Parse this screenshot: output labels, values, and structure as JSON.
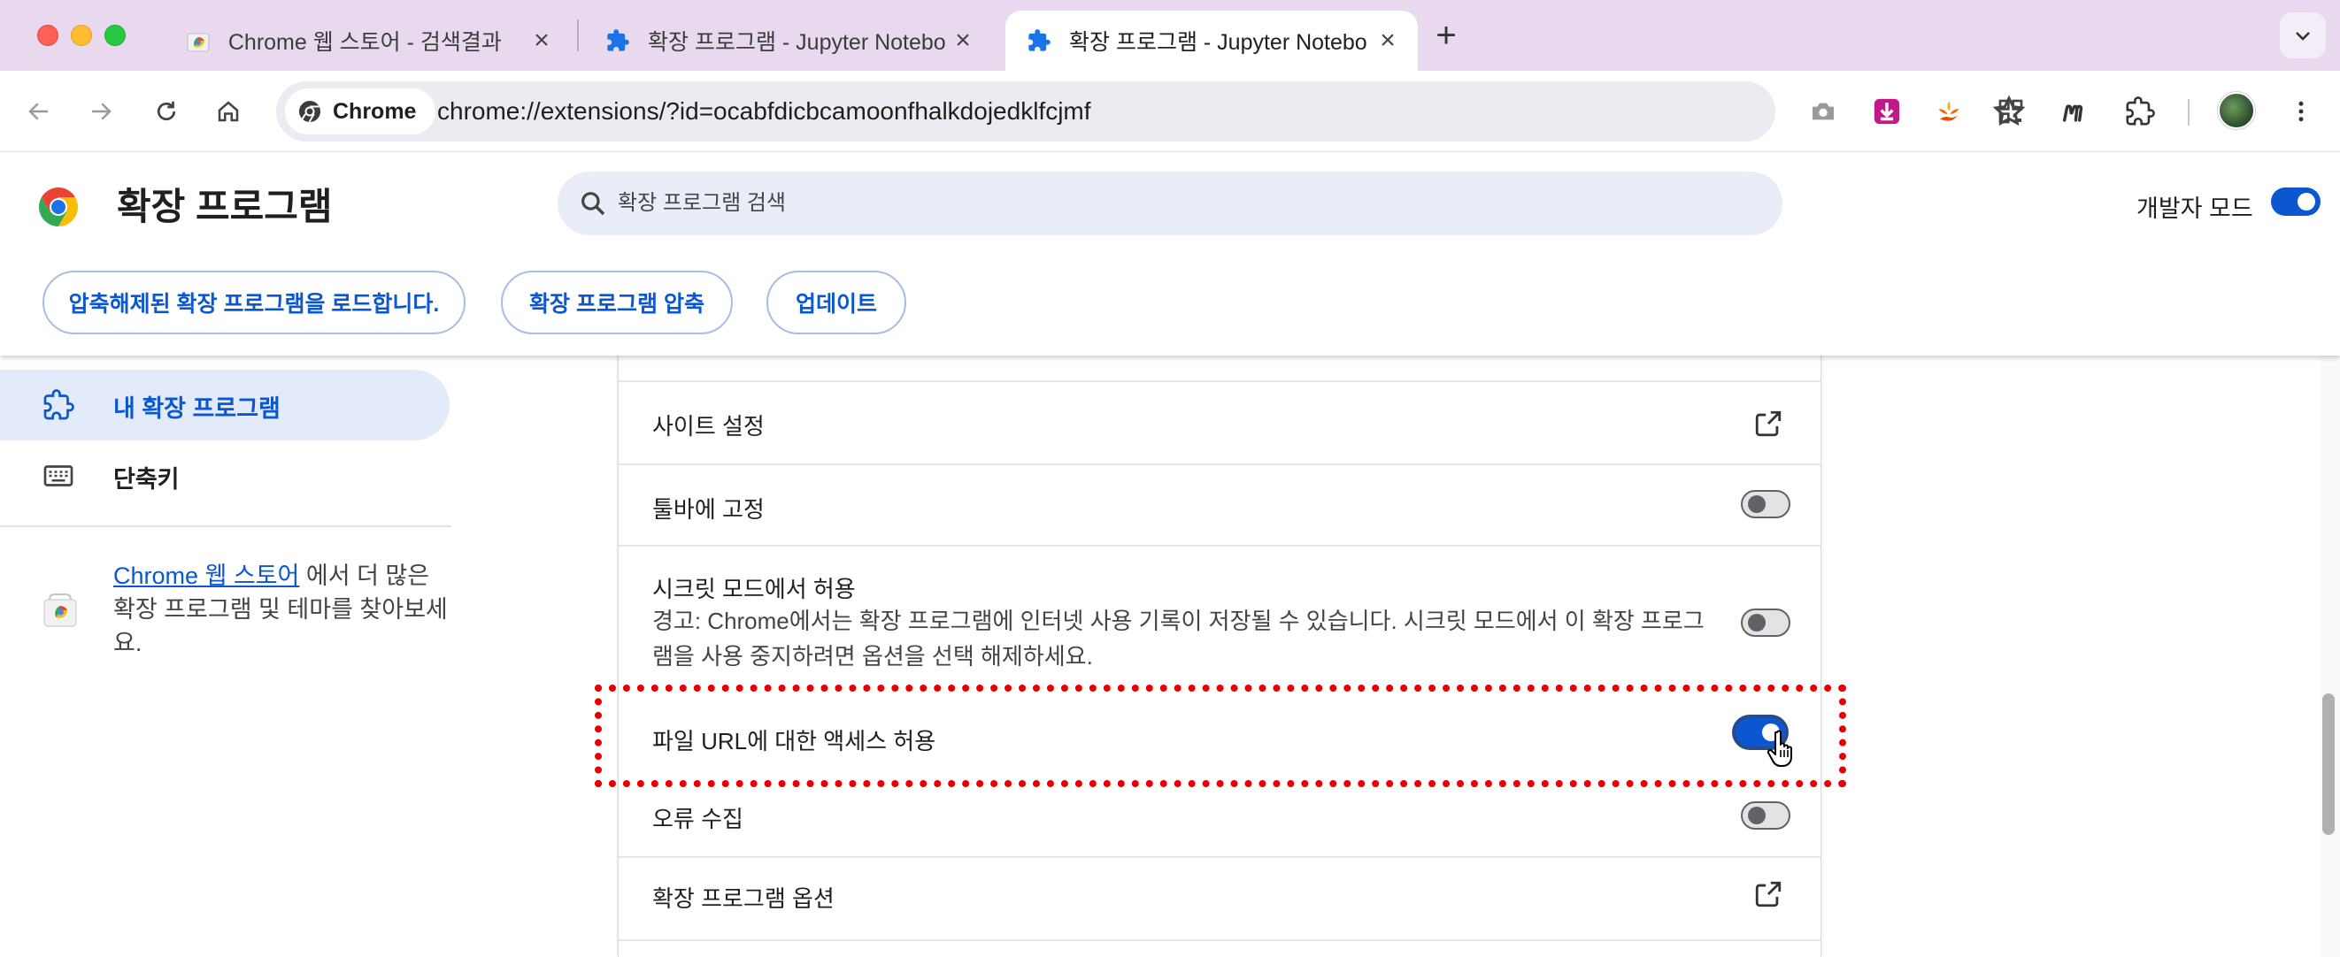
{
  "browser": {
    "tabs": [
      {
        "title": "Chrome 웹 스토어 - 검색결과",
        "icon": "chrome-webstore-icon",
        "active": false
      },
      {
        "title": "확장 프로그램 - Jupyter Notebo",
        "icon": "puzzle-icon",
        "active": false
      },
      {
        "title": "확장 프로그램 - Jupyter Notebo",
        "icon": "puzzle-icon",
        "active": true
      }
    ],
    "new_tab": "+",
    "omnibox": {
      "chip_label": "Chrome",
      "url": "chrome://extensions/?id=ocabfdicbcamoonfhalkdojedklfcjmf"
    }
  },
  "header": {
    "title": "확장 프로그램",
    "search_placeholder": "확장 프로그램 검색",
    "dev_mode_label": "개발자 모드",
    "dev_mode_on": true,
    "buttons": {
      "load_unpacked": "압축해제된 확장 프로그램을 로드합니다.",
      "pack": "확장 프로그램 압축",
      "update": "업데이트"
    }
  },
  "sidebar": {
    "items": [
      {
        "label": "내 확장 프로그램",
        "icon": "puzzle-icon",
        "active": true
      },
      {
        "label": "단축키",
        "icon": "keyboard-icon",
        "active": false
      }
    ],
    "promo": {
      "link_text": "Chrome 웹 스토어",
      "text": " 에서 더 많은 확장 프로그램 및 테마를 찾아보세요."
    }
  },
  "details": {
    "site_settings": "사이트 설정",
    "pin_toolbar": {
      "label": "툴바에 고정",
      "on": false
    },
    "incognito": {
      "label": "시크릿 모드에서 허용",
      "warning": "경고: Chrome에서는 확장 프로그램에 인터넷 사용 기록이 저장될 수 있습니다. 시크릿 모드에서 이 확장 프로그램을 사용 중지하려면 옵션을 선택 해제하세요.",
      "on": false
    },
    "file_urls": {
      "label": "파일 URL에 대한 액세스 허용",
      "on": true
    },
    "error_collection": {
      "label": "오류 수집",
      "on": false
    },
    "ext_options": "확장 프로그램 옵션"
  },
  "colors": {
    "accent": "#0b57d0",
    "highlight_border": "#e60000",
    "tabstrip": "#e8d9ee"
  }
}
